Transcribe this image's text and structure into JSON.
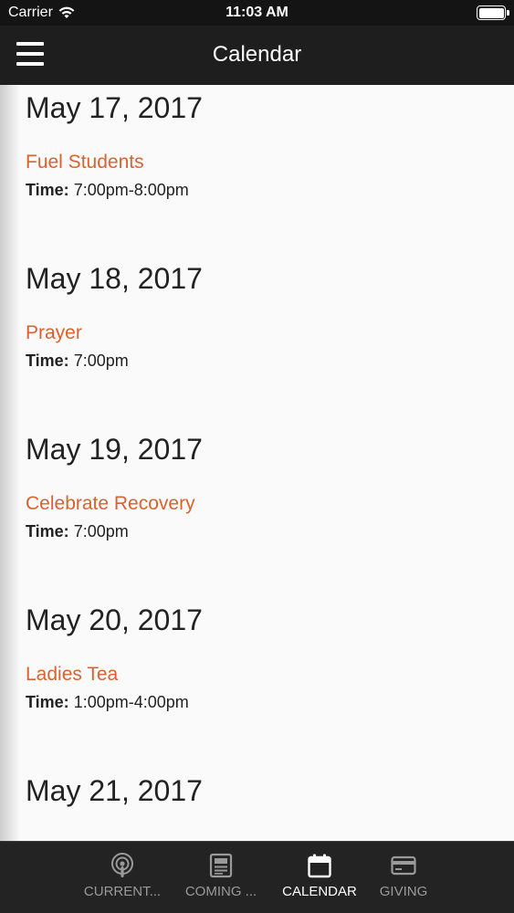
{
  "status_bar": {
    "carrier": "Carrier",
    "time": "11:03 AM",
    "wifi_icon": "wifi-icon",
    "battery_level": 1.0
  },
  "nav_bar": {
    "title": "Calendar",
    "menu_icon": "hamburger-menu-icon"
  },
  "colors": {
    "event_title": "#d9622f",
    "nav_background": "#1e1e1e",
    "content_background": "#fafafa",
    "tab_active": "#ffffff",
    "tab_inactive": "#9a9a9a"
  },
  "days": [
    {
      "date": "May 17, 2017",
      "events": [
        {
          "title": "Fuel Students",
          "time_label": "Time:",
          "time": "7:00pm-8:00pm"
        }
      ]
    },
    {
      "date": "May 18, 2017",
      "events": [
        {
          "title": "Prayer",
          "time_label": "Time:",
          "time": "7:00pm"
        }
      ]
    },
    {
      "date": "May 19, 2017",
      "events": [
        {
          "title": "Celebrate Recovery",
          "time_label": "Time:",
          "time": "7:00pm"
        }
      ]
    },
    {
      "date": "May 20, 2017",
      "events": [
        {
          "title": "Ladies Tea",
          "time_label": "Time:",
          "time": "1:00pm-4:00pm"
        }
      ]
    },
    {
      "date": "May 21, 2017",
      "events": []
    }
  ],
  "tab_bar": {
    "tabs": [
      {
        "label": "CURRENT...",
        "icon": "podcast-icon",
        "active": false
      },
      {
        "label": "COMING ...",
        "icon": "newspaper-icon",
        "active": false
      },
      {
        "label": "CALENDAR",
        "icon": "calendar-icon",
        "active": true
      },
      {
        "label": "GIVING",
        "icon": "credit-card-icon",
        "active": false
      }
    ]
  }
}
